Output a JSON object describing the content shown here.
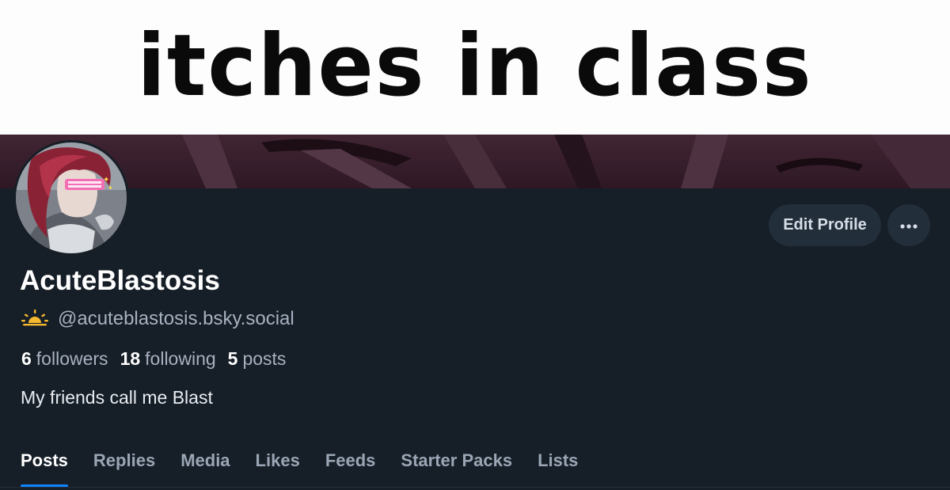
{
  "banner": {
    "text": "itches in class"
  },
  "profile": {
    "display_name": "AcuteBlastosis",
    "handle": "@acuteblastosis.bsky.social",
    "handle_icon": "sun-horizon-emoji-icon",
    "bio": "My friends call me Blast"
  },
  "stats": {
    "followers_count": "6",
    "followers_label": "followers",
    "following_count": "18",
    "following_label": "following",
    "posts_count": "5",
    "posts_label": "posts"
  },
  "actions": {
    "edit_label": "Edit Profile",
    "more_icon": "ellipsis-icon"
  },
  "tabs": [
    {
      "label": "Posts",
      "active": true
    },
    {
      "label": "Replies",
      "active": false
    },
    {
      "label": "Media",
      "active": false
    },
    {
      "label": "Likes",
      "active": false
    },
    {
      "label": "Feeds",
      "active": false
    },
    {
      "label": "Starter Packs",
      "active": false
    },
    {
      "label": "Lists",
      "active": false
    }
  ],
  "colors": {
    "background": "#161e27",
    "accent": "#1083fe",
    "button_bg": "#232e3b",
    "muted_text": "#a7b2c0"
  }
}
